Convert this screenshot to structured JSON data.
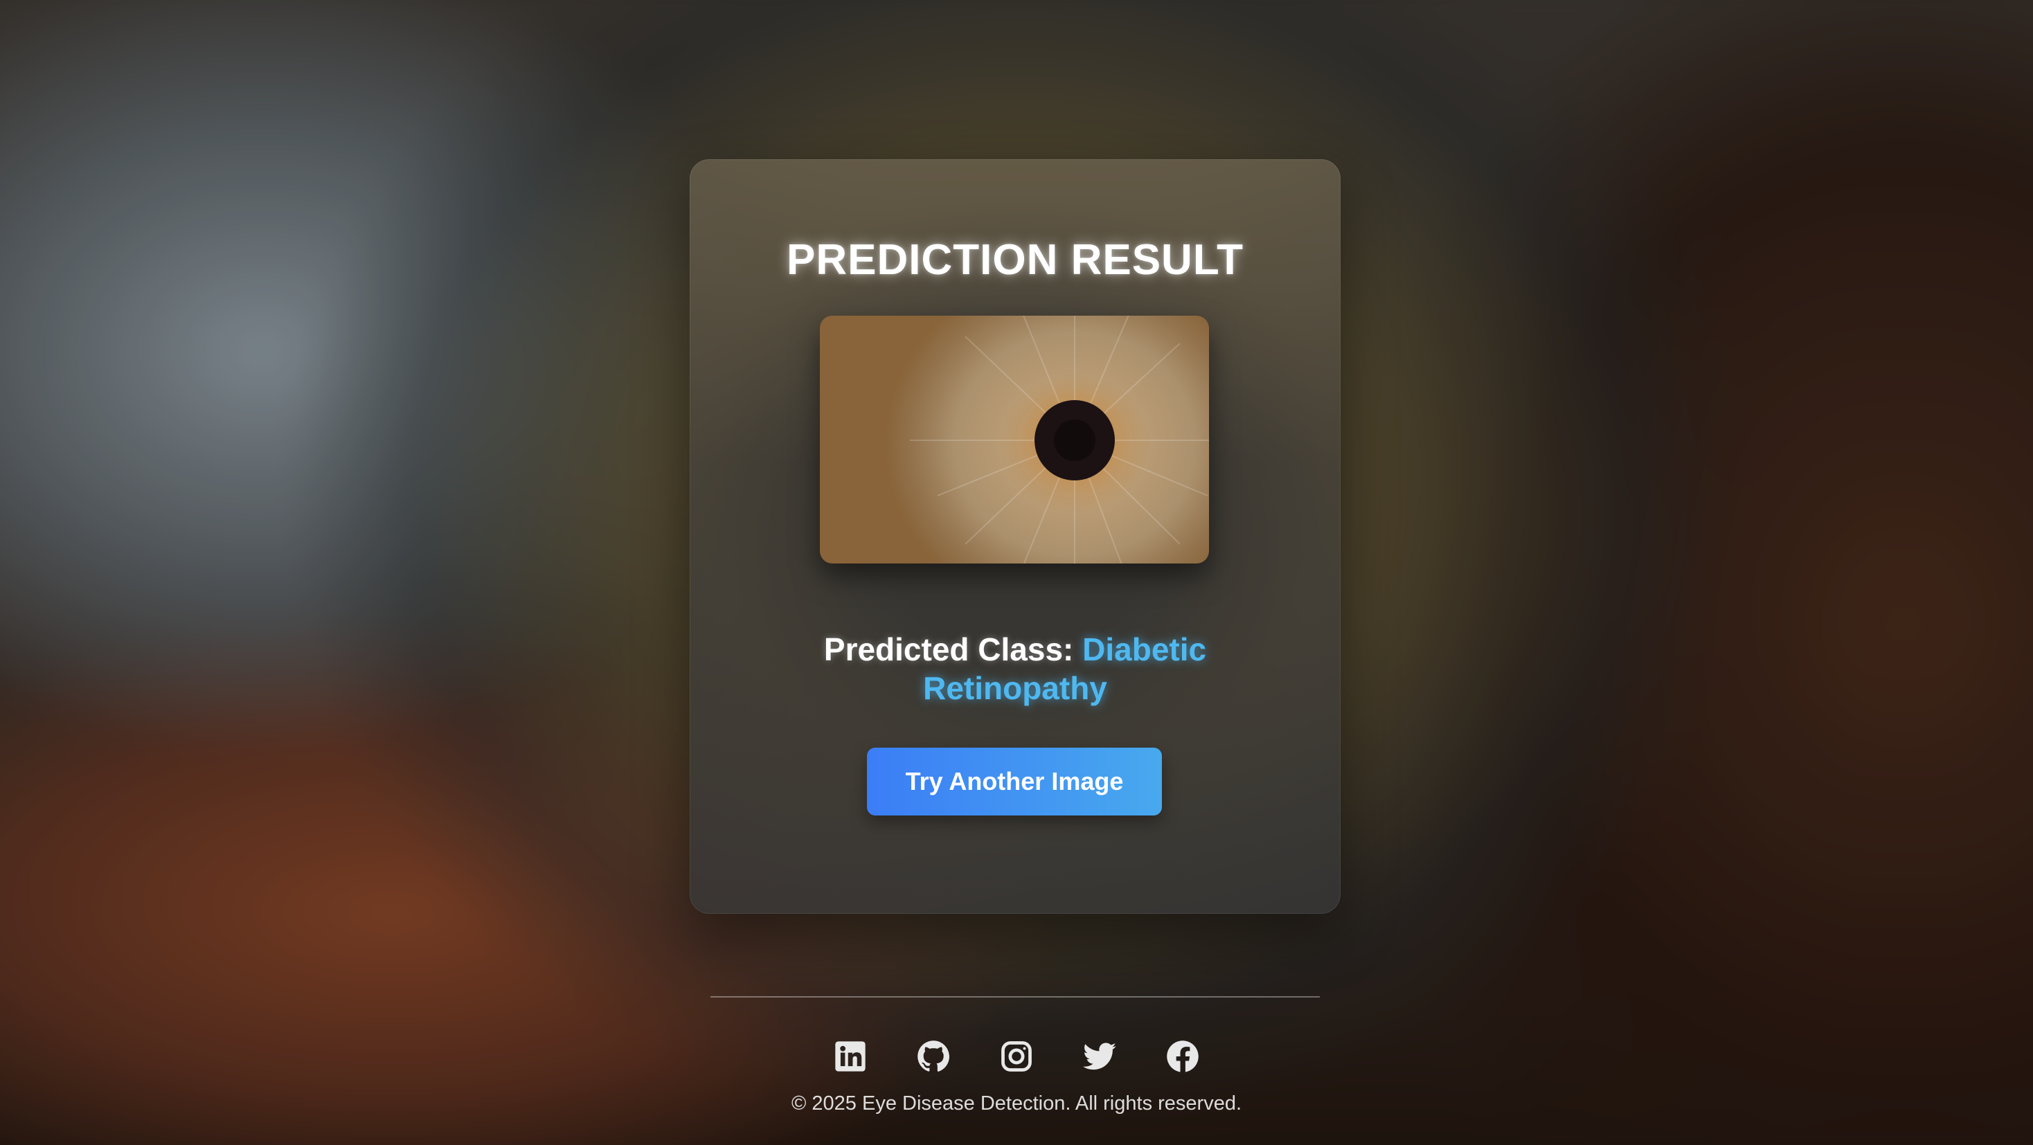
{
  "result": {
    "title": "PREDICTION RESULT",
    "image_alt": "Uploaded eye image",
    "predicted_label": "Predicted Class:",
    "predicted_value": "Diabetic Retinopathy",
    "button_label": "Try Another Image"
  },
  "footer": {
    "social_icons": [
      "linkedin-icon",
      "github-icon",
      "instagram-icon",
      "twitter-icon",
      "facebook-icon"
    ],
    "copyright": "© 2025 Eye Disease Detection. All rights reserved."
  },
  "colors": {
    "accent": "#4fb8f0",
    "button_start": "#3b7df6",
    "button_end": "#48a9ee"
  }
}
